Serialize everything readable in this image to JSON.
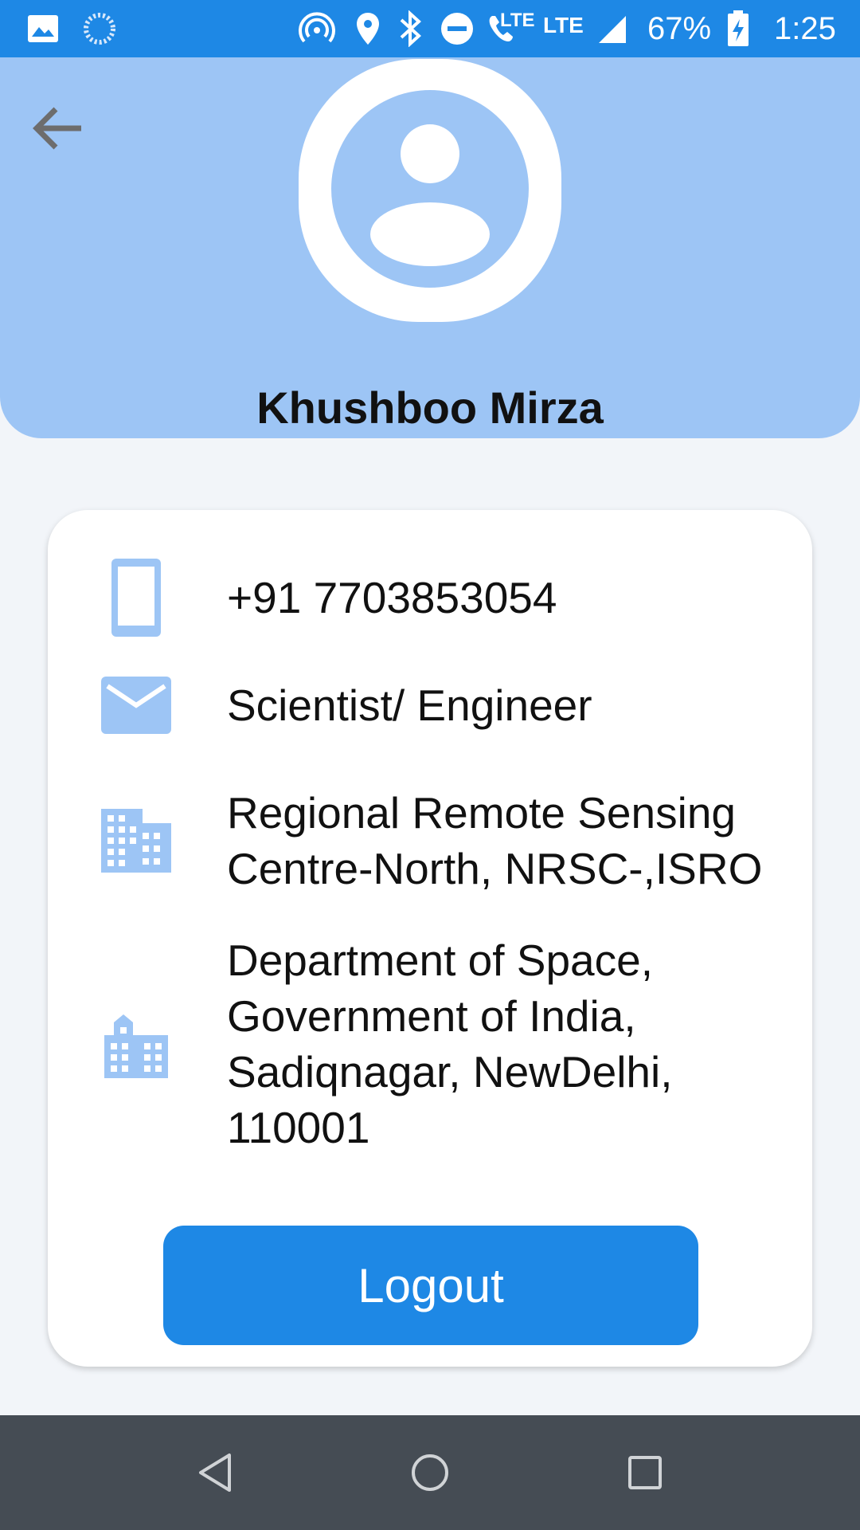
{
  "status_bar": {
    "battery": "67%",
    "time": "1:25",
    "lte1": "LTE",
    "lte2": "LTE",
    "icons": [
      "image-icon",
      "sync-icon",
      "hotspot-icon",
      "location-icon",
      "bluetooth-icon",
      "dnd-icon",
      "volte-call-icon",
      "signal-icon",
      "battery-charging-icon"
    ]
  },
  "header": {
    "back_icon": "arrow-left-icon",
    "avatar_icon": "account-circle-icon",
    "name": "Khushboo Mirza"
  },
  "profile": {
    "rows": [
      {
        "icon": "phone-icon",
        "text": "+91 7703853054"
      },
      {
        "icon": "email-icon",
        "text": "Scientist/ Engineer"
      },
      {
        "icon": "office-building-icon",
        "text": "Regional Remote Sensing\nCentre-North, NRSC-,ISRO"
      },
      {
        "icon": "city-icon",
        "text": "Department of Space,\nGovernment of India,\nSadiqnagar, NewDelhi,\n110001"
      }
    ],
    "logout_label": "Logout"
  },
  "nav_bar": {
    "icons": [
      "back-triangle-icon",
      "home-circle-icon",
      "recents-square-icon"
    ]
  },
  "colors": {
    "accent": "#1e88e5",
    "header_bg": "#9dc5f5",
    "icon_light": "#9dc5f5",
    "nav_bg": "#454c54"
  }
}
